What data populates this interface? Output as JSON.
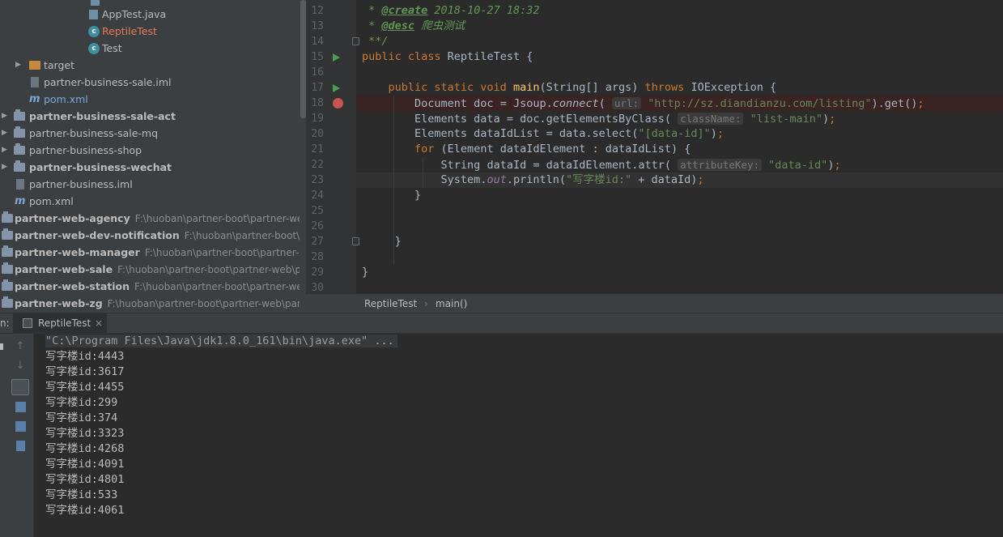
{
  "project_tree": {
    "items": [
      {
        "label": "AppTest.java"
      },
      {
        "label": "ReptileTest"
      },
      {
        "label": "Test"
      },
      {
        "label": "target"
      },
      {
        "label": "partner-business-sale.iml"
      },
      {
        "label": "pom.xml"
      },
      {
        "label": "partner-business-sale-act"
      },
      {
        "label": "partner-business-sale-mq"
      },
      {
        "label": "partner-business-shop"
      },
      {
        "label": "partner-business-wechat"
      },
      {
        "label": "partner-business.iml"
      },
      {
        "label": "pom.xml"
      },
      {
        "label": "partner-web-agency",
        "path": "F:\\huoban\\partner-boot\\partner-web\\pa"
      },
      {
        "label": "partner-web-dev-notification",
        "path": "F:\\huoban\\partner-boot\\partn"
      },
      {
        "label": "partner-web-manager",
        "path": "F:\\huoban\\partner-boot\\partner-web\\"
      },
      {
        "label": "partner-web-sale",
        "path": "F:\\huoban\\partner-boot\\partner-web\\partr"
      },
      {
        "label": "partner-web-station",
        "path": "F:\\huoban\\partner-boot\\partner-web\\pa"
      },
      {
        "label": "partner-web-zg",
        "path": "F:\\huoban\\partner-boot\\partner-web\\partne"
      }
    ]
  },
  "editor": {
    "line_numbers": [
      "12",
      "13",
      "14",
      "15",
      "16",
      "17",
      "18",
      "19",
      "20",
      "21",
      "22",
      "23",
      "24",
      "25",
      "26",
      "27",
      "28",
      "29",
      "30"
    ],
    "code": {
      "l12_tag": "@create",
      "l12_text": " 2018-10-27 18:32",
      "l13_tag": "@desc",
      "l13_text": " 爬虫测试",
      "l14": " **/",
      "l15_kw": "public class",
      "l15_name": " ReptileTest {",
      "l17_kw": "public static void",
      "l17_fn": "main",
      "l17_args": "(String[] args) ",
      "l17_throws": "throws",
      "l17_exc": " IOException {",
      "l18_a": "Document doc = Jsoup.",
      "l18_fn": "connect",
      "l18_hint": "url:",
      "l18_str": "\"http://sz.diandianzu.com/listing\"",
      "l18_end": ").get()",
      "l19_a": "Elements data = doc.getElementsByClass(",
      "l19_hint": "className:",
      "l19_str": "\"list-main\"",
      "l19_end": ")",
      "l20_a": "Elements dataIdList = data.select(",
      "l20_str": "\"[data-id]\"",
      "l20_end": ")",
      "l21_kw": "for",
      "l21_text": " (Element dataIdElement : dataIdList) {",
      "l22_a": "String dataId = dataIdElement.attr(",
      "l22_hint": "attributeKey:",
      "l22_str": "\"data-id\"",
      "l22_end": ")",
      "l23_a": "System.",
      "l23_out": "out",
      "l23_b": ".println(",
      "l23_str": "\"写字楼id:\"",
      "l23_end": " + dataId)",
      "l24": "}",
      "l27": "}",
      "l29": "}"
    }
  },
  "breadcrumb": {
    "class": "ReptileTest",
    "method": "main()"
  },
  "run_panel": {
    "prefix": "n:",
    "tab_label": "ReptileTest",
    "command": "\"C:\\Program Files\\Java\\jdk1.8.0_161\\bin\\java.exe\" ...",
    "output": [
      "写字楼id:4443",
      "写字楼id:3617",
      "写字楼id:4455",
      "写字楼id:299",
      "写字楼id:374",
      "写字楼id:3323",
      "写字楼id:4268",
      "写字楼id:4091",
      "写字楼id:4801",
      "写字楼id:533",
      "写字楼id:4061"
    ]
  },
  "colors": {
    "keyword": "#cc7832",
    "string": "#6a8759",
    "function": "#ffc66d",
    "comment": "#629755",
    "breakpoint": "#c75450",
    "run_arrow": "#499c54"
  }
}
